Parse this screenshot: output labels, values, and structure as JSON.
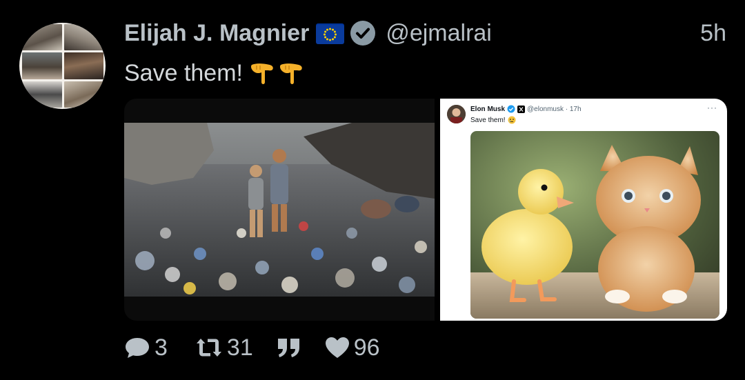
{
  "author": {
    "name": "Elijah J. Magnier",
    "handle": "@ejmalrai",
    "flag_icon": "eu-flag-icon",
    "verified_icon": "verified-badge-icon",
    "avatar_icon": "profile-photo-collage"
  },
  "timestamp": "5h",
  "tweet": {
    "text": "Save them!",
    "emoji": [
      "backhand-index-pointing-down",
      "backhand-index-pointing-down"
    ]
  },
  "media": {
    "left": {
      "icon": "photo-children-in-garbage-dump"
    },
    "embedded": {
      "name": "Elon Musk",
      "handle": "@elonmusk · 17h",
      "more": "···",
      "text": "Save them!",
      "image_icon": "photo-duckling-and-kitten"
    }
  },
  "actions": {
    "replies": "3",
    "retweets": "31",
    "quotes_icon": "quote-icon",
    "likes": "96"
  },
  "colors": {
    "background": "#000000",
    "text_gray": "#b9c1c7",
    "verified": "#8a9aa4",
    "emoji": "#f5b12a"
  }
}
